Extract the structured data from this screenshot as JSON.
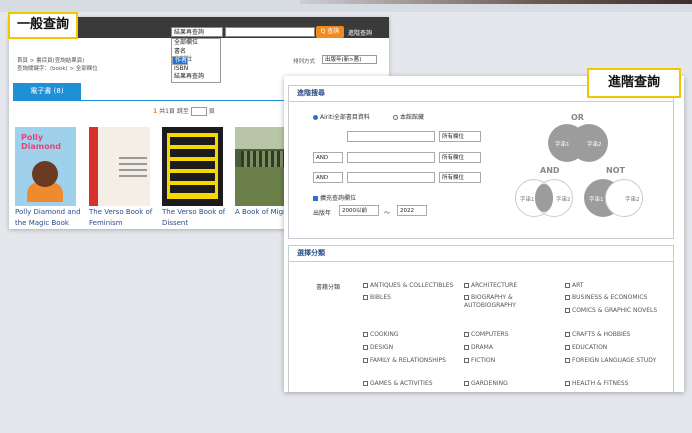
{
  "labels": {
    "basic": "一般查詢",
    "advanced": "進階查詢"
  },
  "basic": {
    "scope_value": "結果再查詢",
    "search_button": "Q 查詢",
    "advanced_link": "進階查詢",
    "scope_options": [
      "全部欄位",
      "書名",
      "作者",
      "出版社",
      "ISBN",
      "結果再查詢"
    ],
    "selected_option_index": 2,
    "breadcrumb_line1": "首頁 > 書目頁(查詢結果頁)",
    "breadcrumb_line2": "查詢關鍵字：(book) > 全部欄位",
    "sort_label": "排列方式",
    "sort_value": "出版年(新>舊)",
    "tab_ebook": "電子書 (8)",
    "pager": {
      "page": "1",
      "total": "共1頁",
      "jump": "跳至",
      "page_unit": "頁",
      "page_select": "1"
    },
    "books": [
      {
        "title": "Polly Diamond and the Magic Book",
        "cover_text": "Polly Diamond"
      },
      {
        "title": "The Verso Book of Feminism",
        "cover_text": ""
      },
      {
        "title": "The Verso Book of Dissent",
        "cover_text": ""
      },
      {
        "title": "A Book of Migrations",
        "cover_text": ""
      }
    ]
  },
  "advanced": {
    "panel_title": "進階搜尋",
    "radio_all": "Airiti全部書目資料",
    "radio_local": "本館館藏",
    "field_options": "所有欄位",
    "operator": "AND",
    "checkbox_label": "擴充查詢欄位",
    "year_label": "出版年",
    "year_from": "2000以前",
    "year_to": "2022",
    "year_sep": "～",
    "venn": {
      "or": "OR",
      "and": "AND",
      "not": "NOT",
      "term1": "字串1",
      "term2": "字串2"
    },
    "category_panel_title": "選擇分類",
    "category_label": "書籍分類",
    "categories": [
      [
        "ANTIQUES & COLLECTIBLES",
        "ARCHITECTURE",
        "ART"
      ],
      [
        "BIBLES",
        "BIOGRAPHY & AUTOBIOGRAPHY",
        "BUSINESS & ECONOMICS"
      ],
      [
        "",
        "",
        "COMICS & GRAPHIC NOVELS"
      ],
      [
        "COOKING",
        "COMPUTERS",
        "CRAFTS & HOBBIES"
      ],
      [
        "DESIGN",
        "DRAMA",
        "EDUCATION"
      ],
      [
        "FAMILY & RELATIONSHIPS",
        "FICTION",
        "FOREIGN LANGUAGE STUDY"
      ],
      [
        "GAMES & ACTIVITIES",
        "GARDENING",
        "HEALTH & FITNESS"
      ]
    ]
  }
}
